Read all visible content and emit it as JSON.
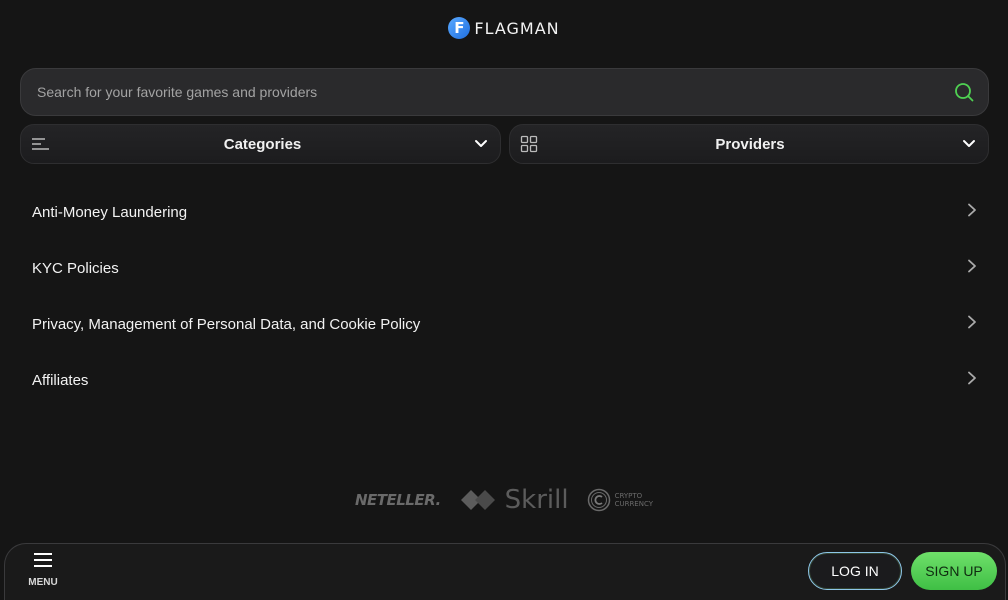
{
  "header": {
    "logo_letter": "F",
    "logo_text": "FLAGMAN"
  },
  "search": {
    "placeholder": "Search for your favorite games and providers",
    "value": ""
  },
  "filters": {
    "categories_label": "Categories",
    "providers_label": "Providers"
  },
  "links": [
    {
      "label": "Anti-Money Laundering"
    },
    {
      "label": "KYC Policies"
    },
    {
      "label": "Privacy, Management of Personal Data, and Cookie Policy"
    },
    {
      "label": "Affiliates"
    }
  ],
  "payments": {
    "neteller": "NETELLER.",
    "skrill": "Skrill",
    "crypto_line1": "CRYPTO",
    "crypto_line2": "CURRENCY"
  },
  "bottombar": {
    "menu_label": "MENU",
    "login_label": "LOG IN",
    "signup_label": "SIGN UP"
  },
  "colors": {
    "background": "#151515",
    "accent_green": "#4fd152",
    "logo_blue": "#2f86f0"
  },
  "icons": {
    "search": "search-icon",
    "categories": "list-icon",
    "providers": "grid-icon",
    "chevron": "chevron-right-icon",
    "menu": "hamburger-icon"
  }
}
